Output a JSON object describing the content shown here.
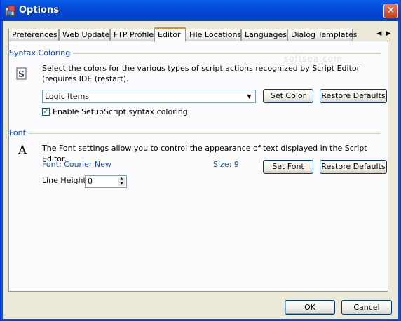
{
  "window": {
    "title": "Options",
    "close_glyph": "✕"
  },
  "tabs": [
    {
      "label": "Preferences"
    },
    {
      "label": "Web Update"
    },
    {
      "label": "FTP Profile"
    },
    {
      "label": "Editor",
      "active": true
    },
    {
      "label": "File Locations"
    },
    {
      "label": "Languages"
    },
    {
      "label": "Dialog Templates"
    }
  ],
  "tab_scroll": {
    "left": "◀",
    "right": "▶"
  },
  "watermark": "softsea.com",
  "syntax": {
    "title": "Syntax Coloring",
    "icon": "S",
    "description": "Select the colors for the various types of script actions recognized by Script Editor (requires IDE (restart).",
    "dropdown_value": "Logic Items",
    "dropdown_arrow": "▼",
    "set_color_label": "Set Color",
    "restore_label": "Restore Defaults",
    "checkbox_label": "Enable SetupScript syntax coloring",
    "checkbox_mark": "✓",
    "checkbox_checked": true
  },
  "font": {
    "title": "Font",
    "icon": "A",
    "description": "The Font settings allow you to control the appearance of text displayed in the Script Editor.",
    "font_label": "Font: Courier New",
    "size_label": "Size: 9",
    "set_font_label": "Set Font",
    "restore_label": "Restore Defaults",
    "line_height_label": "Line Height:",
    "line_height_value": "0",
    "spin_up": "▲",
    "spin_down": "▼"
  },
  "footer": {
    "ok_label": "OK",
    "cancel_label": "Cancel"
  },
  "colors": {
    "titlebar": "#0055e5",
    "group_title": "#0046d5",
    "info_text": "#1c4fa0",
    "active_tab_accent": "#e68b2c"
  }
}
